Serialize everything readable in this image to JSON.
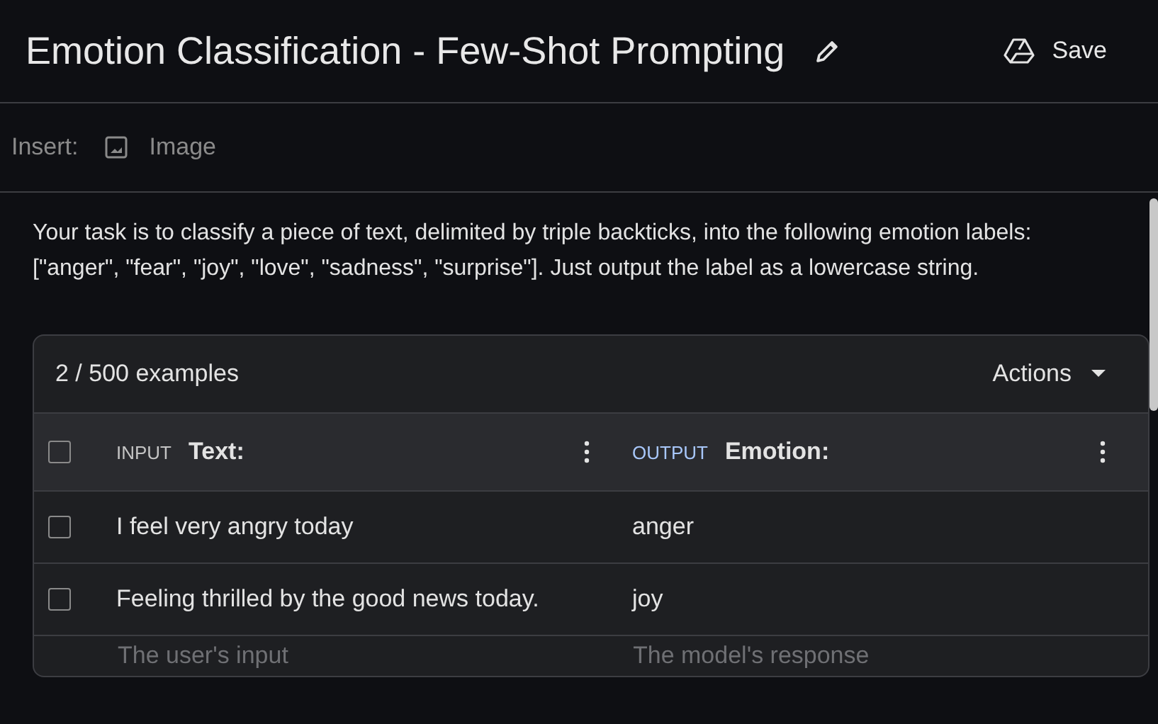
{
  "title": "Emotion Classification - Few-Shot Prompting",
  "save_button": "Save",
  "insert_bar": {
    "label": "Insert:",
    "items": [
      {
        "label": "Image"
      }
    ]
  },
  "prompt": "Your task is to classify a piece of text, delimited by triple backticks, into the following emotion labels: [\"anger\", \"fear\", \"joy\", \"love\", \"sadness\", \"surprise\"]. Just output the label as a lowercase string.",
  "examples": {
    "count": "2 / 500 examples",
    "actions": "Actions",
    "header_checkbox": {
      "checked": false
    },
    "columns": [
      {
        "kind": "input",
        "tag": "INPUT",
        "label": "Text:"
      },
      {
        "kind": "output",
        "tag": "OUTPUT",
        "label": "Emotion:"
      }
    ],
    "rows": [
      {
        "checked": false,
        "cells": [
          "I feel very angry today",
          "anger"
        ]
      },
      {
        "checked": false,
        "cells": [
          "Feeling thrilled by the good news today.",
          "joy"
        ]
      }
    ],
    "new_row": {
      "placeholders": [
        "The user's input",
        "The model's response"
      ]
    }
  }
}
